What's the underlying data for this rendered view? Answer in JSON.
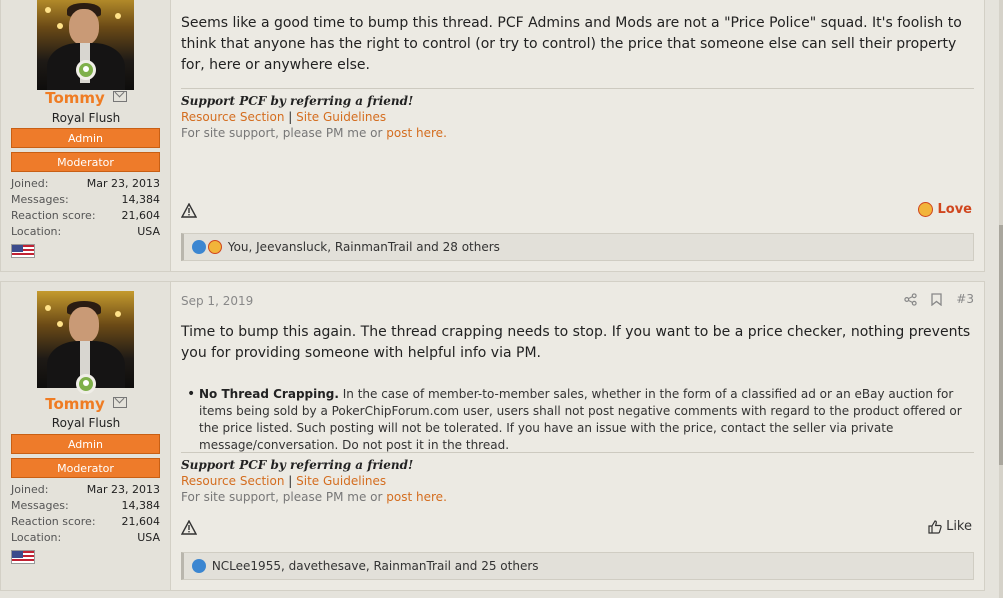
{
  "post1": {
    "user": {
      "name": "Tommy",
      "title": "Royal Flush",
      "banners": [
        "Admin",
        "Moderator"
      ]
    },
    "stats": [
      {
        "label": "Joined:",
        "value": "Mar 23, 2013"
      },
      {
        "label": "Messages:",
        "value": "14,384"
      },
      {
        "label": "Reaction score:",
        "value": "21,604"
      },
      {
        "label": "Location:",
        "value": "USA"
      }
    ],
    "body": "Seems like a good time to bump this thread. PCF Admins and Mods are not a \"Price Police\" squad. It's foolish to think that anyone has the right to control (or try to control) the price that someone else can sell their property for, here or anywhere else.",
    "signature": {
      "heading": "Support PCF by referring a friend!",
      "link1": "Resource Section",
      "sep": "|",
      "link2": "Site Guidelines",
      "support_text": "For site support, please PM me or",
      "support_link": "post here."
    },
    "reaction_button": "Love",
    "reactions_text": "You, Jeevansluck, RainmanTrail and 28 others"
  },
  "post2": {
    "date": "Sep 1, 2019",
    "number": "#3",
    "user": {
      "name": "Tommy",
      "title": "Royal Flush",
      "banners": [
        "Admin",
        "Moderator"
      ]
    },
    "stats": [
      {
        "label": "Joined:",
        "value": "Mar 23, 2013"
      },
      {
        "label": "Messages:",
        "value": "14,384"
      },
      {
        "label": "Reaction score:",
        "value": "21,604"
      },
      {
        "label": "Location:",
        "value": "USA"
      }
    ],
    "body": "Time to bump this again. The thread crapping needs to stop. If you want to be a price checker, nothing prevents you for providing someone with helpful info via PM.",
    "bullet_title": "No Thread Crapping.",
    "bullet_text": " In the case of member-to-member sales, whether in the form of a classified ad or an eBay auction for items being sold by a PokerChipForum.com user, users shall not post negative comments with regard to the product offered or the price listed. Such posting will not be tolerated. If you have an issue with the price, contact the seller via private message/conversation. Do not post it in the thread.",
    "signature": {
      "heading": "Support PCF by referring a friend!",
      "link1": "Resource Section",
      "sep": "|",
      "link2": "Site Guidelines",
      "support_text": "For site support, please PM me or",
      "support_link": "post here."
    },
    "reaction_button": "Like",
    "reactions_text": "NCLee1955, davethesave, RainmanTrail and 25 others"
  },
  "icons": [
    "share-icon",
    "bookmark-icon",
    "report-icon",
    "mail-icon",
    "like-icon",
    "love-icon"
  ],
  "colors": {
    "accent": "#ef7c23",
    "link": "#d46d1f",
    "love": "#d0461e",
    "like": "#3b86d1"
  }
}
